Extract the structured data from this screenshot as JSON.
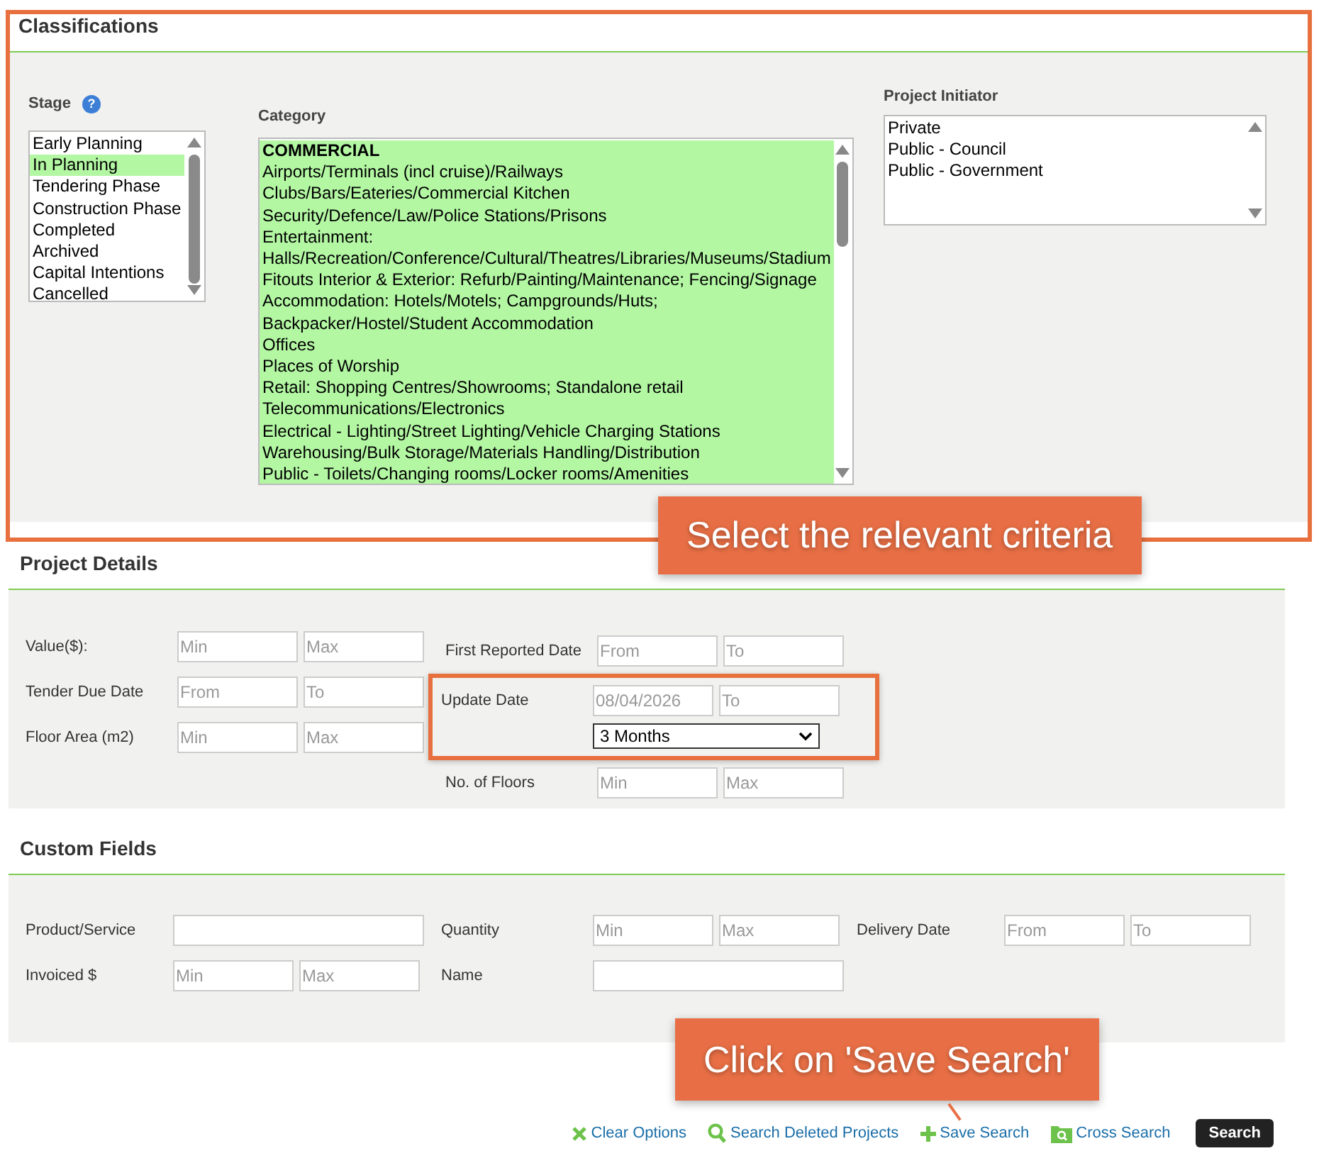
{
  "classifications": {
    "title": "Classifications",
    "highlighted": true,
    "callout": "Select the relevant criteria",
    "stage": {
      "label": "Stage",
      "help": "?",
      "options": [
        {
          "label": "Early Planning",
          "selected": false
        },
        {
          "label": "In Planning",
          "selected": true
        },
        {
          "label": "Tendering Phase",
          "selected": false
        },
        {
          "label": "Construction Phase",
          "selected": false
        },
        {
          "label": "Completed",
          "selected": false
        },
        {
          "label": "Archived",
          "selected": false
        },
        {
          "label": "Capital Intentions",
          "selected": false
        },
        {
          "label": "Cancelled",
          "selected": false
        }
      ]
    },
    "category": {
      "label": "Category",
      "options": [
        {
          "label": "COMMERCIAL",
          "kind": "heading",
          "selected": true
        },
        {
          "label": "Airports/Terminals (incl cruise)/Railways",
          "kind": "item",
          "selected": true
        },
        {
          "label": "Clubs/Bars/Eateries/Commercial Kitchen",
          "kind": "item",
          "selected": true
        },
        {
          "label": "Security/Defence/Law/Police Stations/Prisons",
          "kind": "item",
          "selected": true
        },
        {
          "label": "Entertainment: Halls/Recreation/Conference/Cultural/Theatres/Libraries/Museums/Stadium",
          "kind": "item",
          "selected": true
        },
        {
          "label": "Fitouts Interior & Exterior: Refurb/Painting/Maintenance; Fencing/Signage",
          "kind": "item",
          "selected": true
        },
        {
          "label": "Accommodation: Hotels/Motels; Campgrounds/Huts; Backpacker/Hostel/Student Accommodation",
          "kind": "item",
          "selected": true
        },
        {
          "label": "Offices",
          "kind": "item",
          "selected": true
        },
        {
          "label": "Places of Worship",
          "kind": "item",
          "selected": true
        },
        {
          "label": "Retail: Shopping Centres/Showrooms; Standalone retail",
          "kind": "item",
          "selected": true
        },
        {
          "label": "Telecommunications/Electronics",
          "kind": "item",
          "selected": true
        },
        {
          "label": "Electrical - Lighting/Street Lighting/Vehicle Charging Stations",
          "kind": "item",
          "selected": true
        },
        {
          "label": "Warehousing/Bulk Storage/Materials Handling/Distribution",
          "kind": "item",
          "selected": true
        },
        {
          "label": "Public - Toilets/Changing rooms/Locker rooms/Amenities",
          "kind": "item",
          "selected": true
        }
      ]
    },
    "project_initiator": {
      "label": "Project Initiator",
      "options": [
        {
          "label": "Private",
          "selected": false
        },
        {
          "label": "Public - Council",
          "selected": false
        },
        {
          "label": "Public - Government",
          "selected": false
        }
      ]
    }
  },
  "project_details": {
    "title": "Project Details",
    "left": [
      {
        "label": "Value($):",
        "inputs": [
          {
            "placeholder": "Min"
          },
          {
            "placeholder": "Max"
          }
        ]
      },
      {
        "label": "Tender Due Date",
        "inputs": [
          {
            "placeholder": "From"
          },
          {
            "placeholder": "To"
          }
        ]
      },
      {
        "label": "Floor Area (m2)",
        "inputs": [
          {
            "placeholder": "Min"
          },
          {
            "placeholder": "Max"
          }
        ]
      }
    ],
    "right": [
      {
        "label": "First Reported Date",
        "inputs": [
          {
            "placeholder": "From"
          },
          {
            "placeholder": "To"
          }
        ],
        "highlighted": false
      },
      {
        "label": "Update Date",
        "inputs": [
          {
            "value": "08/04/2026"
          },
          {
            "placeholder": "To"
          }
        ],
        "select": "3 Months",
        "highlighted": true
      },
      {
        "label": "No. of Floors",
        "inputs": [
          {
            "placeholder": "Min"
          },
          {
            "placeholder": "Max"
          }
        ],
        "highlighted": false
      }
    ]
  },
  "custom_fields": {
    "title": "Custom Fields",
    "rows": [
      [
        {
          "label": "Product/Service",
          "kind": "wide"
        },
        {
          "label": "Quantity",
          "inputs": [
            {
              "placeholder": "Min"
            },
            {
              "placeholder": "Max"
            }
          ],
          "kind": "pair"
        },
        {
          "label": "Delivery Date",
          "inputs": [
            {
              "placeholder": "From"
            },
            {
              "placeholder": "To"
            }
          ],
          "kind": "pair"
        }
      ],
      [
        {
          "label": "Invoiced $",
          "inputs": [
            {
              "placeholder": "Min"
            },
            {
              "placeholder": "Max"
            }
          ],
          "kind": "pair"
        },
        {
          "label": "Name",
          "kind": "wide"
        }
      ]
    ]
  },
  "actions": {
    "callout": "Click on 'Save Search'",
    "links": [
      {
        "label": "Clear Options",
        "kind": "clear",
        "pointed": false
      },
      {
        "label": "Search Deleted Projects",
        "kind": "search",
        "pointed": false
      },
      {
        "label": "Save Search",
        "kind": "save",
        "pointed": true
      },
      {
        "label": "Cross Search",
        "kind": "cross",
        "pointed": false
      }
    ],
    "button": "Search"
  }
}
